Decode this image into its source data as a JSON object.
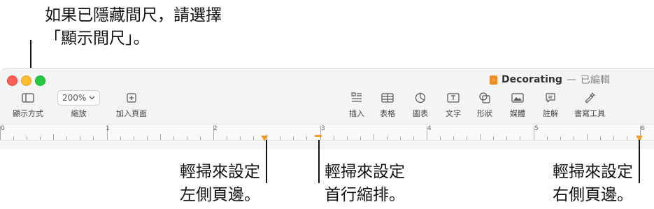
{
  "callouts": {
    "top": "如果已隱藏間尺，請選擇\n「顯示間尺」。",
    "left_margin": "輕掃來設定\n左側頁邊。",
    "first_indent": "輕掃來設定\n首行縮排。",
    "right_margin": "輕掃來設定\n右側頁邊。"
  },
  "window": {
    "doc_name": "Decorating",
    "separator": "—",
    "status": "已編輯"
  },
  "toolbar": {
    "view_label": "顯示方式",
    "zoom_value": "200%",
    "zoom_label": "縮放",
    "add_page_label": "加入頁面",
    "insert_label": "插入",
    "table_label": "表格",
    "chart_label": "圖表",
    "text_label": "文字",
    "shape_label": "形狀",
    "media_label": "媒體",
    "comment_label": "註解",
    "writing_tools_label": "書寫工具"
  },
  "ruler": {
    "numbers": [
      "0",
      "1",
      "2",
      "3",
      "4",
      "5",
      "6"
    ]
  },
  "colors": {
    "accent": "#f39a2a",
    "close": "#fe5f57",
    "minimize": "#febc2e",
    "zoom": "#28c840"
  }
}
